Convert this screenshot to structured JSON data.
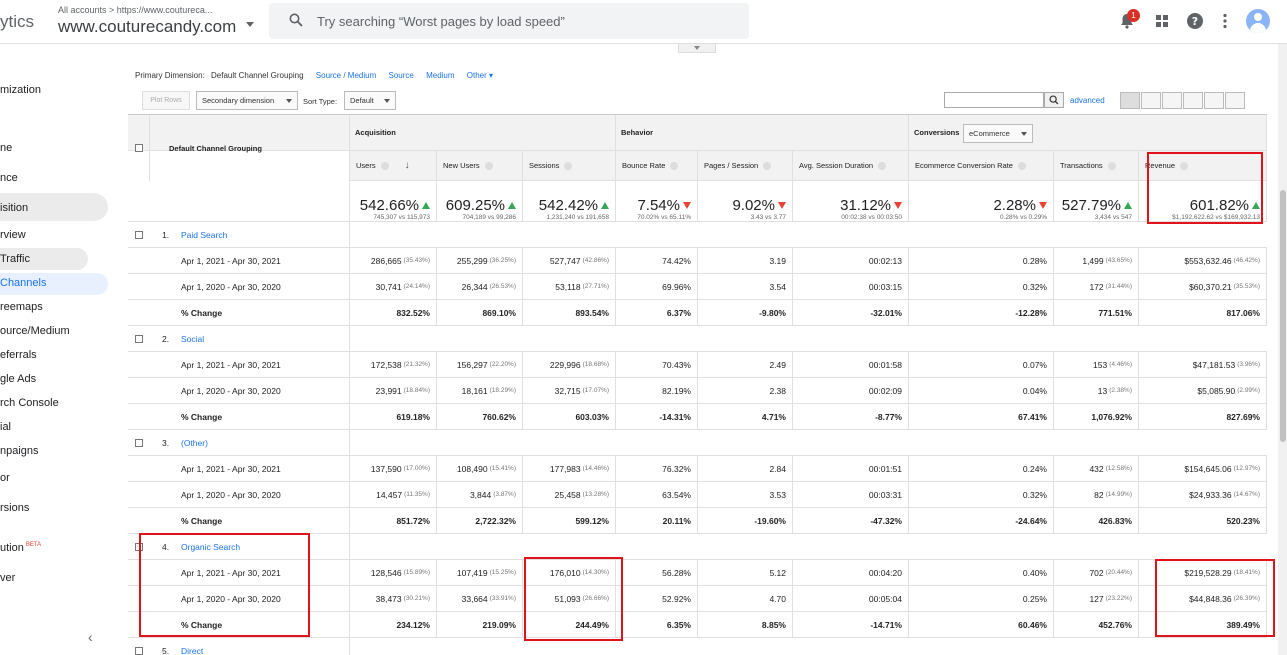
{
  "topbar": {
    "brand": "ytics",
    "account_crumb": "All accounts > https://www.couturecа...",
    "account_name": "www.couturecandy.com",
    "search_placeholder": "Try searching “Worst pages by load speed”",
    "notification_count": "1"
  },
  "sidebar": {
    "items": [
      {
        "label": "mization",
        "top": 0
      },
      {
        "label": "ne"
      },
      {
        "label": "nce"
      },
      {
        "label": "isition"
      },
      {
        "label": "rview"
      },
      {
        "label": "Traffic"
      },
      {
        "label": "Channels"
      },
      {
        "label": "reemaps"
      },
      {
        "label": "ource/Medium"
      },
      {
        "label": "eferrals"
      },
      {
        "label": "gle Ads"
      },
      {
        "label": "rch Console"
      },
      {
        "label": "ial"
      },
      {
        "label": "npaigns"
      },
      {
        "label": "or"
      },
      {
        "label": "rsions"
      },
      {
        "label": "ution"
      },
      {
        "label": "ver"
      }
    ],
    "beta": "BETA",
    "collapse": "‹"
  },
  "primary_dimension": {
    "label": "Primary Dimension:",
    "active": "Default Channel Grouping",
    "options": [
      "Source / Medium",
      "Source",
      "Medium",
      "Other ▾"
    ]
  },
  "controls": {
    "plot_rows": "Plot Rows",
    "secondary_dimension": "Secondary dimension",
    "sort_type_label": "Sort Type:",
    "sort_type_value": "Default",
    "advanced": "advanced"
  },
  "table": {
    "group_header": "Default Channel Grouping",
    "section_acquisition": "Acquisition",
    "section_behavior": "Behavior",
    "section_conversions": "Conversions",
    "conversions_select": "eCommerce",
    "columns": [
      "Users",
      "New Users",
      "Sessions",
      "Bounce Rate",
      "Pages / Session",
      "Avg. Session Duration",
      "Ecommerce Conversion Rate",
      "Transactions",
      "Revenue"
    ],
    "summary": [
      {
        "big": "542.66%",
        "sub": "745,307 vs 115,973",
        "dir": "up"
      },
      {
        "big": "609.25%",
        "sub": "704,189 vs 99,286",
        "dir": "up"
      },
      {
        "big": "542.42%",
        "sub": "1,231,240 vs 191,658",
        "dir": "up"
      },
      {
        "big": "7.54%",
        "sub": "70.02% vs 65.11%",
        "dir": "down"
      },
      {
        "big": "9.02%",
        "sub": "3.43 vs 3.77",
        "dir": "down"
      },
      {
        "big": "31.12%",
        "sub": "00:02:38 vs 00:03:50",
        "dir": "down"
      },
      {
        "big": "2.28%",
        "sub": "0.28% vs 0.29%",
        "dir": "down"
      },
      {
        "big": "527.79%",
        "sub": "3,434 vs 547",
        "dir": "up"
      },
      {
        "big": "601.82%",
        "sub": "$1,192,622.62 vs $169,932.13",
        "dir": "up"
      }
    ],
    "groups": [
      {
        "num": "1.",
        "name": "Paid Search",
        "rows": [
          {
            "label": "Apr 1, 2021 - Apr 30, 2021",
            "cells": [
              [
                "286,665",
                "(35.43%)"
              ],
              [
                "255,299",
                "(36.25%)"
              ],
              [
                "527,747",
                "(42.86%)"
              ],
              [
                "74.42%",
                ""
              ],
              [
                "3.19",
                ""
              ],
              [
                "00:02:13",
                ""
              ],
              [
                "0.28%",
                ""
              ],
              [
                "1,499",
                "(43.65%)"
              ],
              [
                "$553,632.46",
                "(46.42%)"
              ]
            ]
          },
          {
            "label": "Apr 1, 2020 - Apr 30, 2020",
            "cells": [
              [
                "30,741",
                "(24.14%)"
              ],
              [
                "26,344",
                "(26.53%)"
              ],
              [
                "53,118",
                "(27.71%)"
              ],
              [
                "69.96%",
                ""
              ],
              [
                "3.54",
                ""
              ],
              [
                "00:03:15",
                ""
              ],
              [
                "0.32%",
                ""
              ],
              [
                "172",
                "(31.44%)"
              ],
              [
                "$60,370.21",
                "(35.53%)"
              ]
            ]
          },
          {
            "label": "% Change",
            "bold": true,
            "cells": [
              [
                "832.52%",
                ""
              ],
              [
                "869.10%",
                ""
              ],
              [
                "893.54%",
                ""
              ],
              [
                "6.37%",
                ""
              ],
              [
                "-9.80%",
                ""
              ],
              [
                "-32.01%",
                ""
              ],
              [
                "-12.28%",
                ""
              ],
              [
                "771.51%",
                ""
              ],
              [
                "817.06%",
                ""
              ]
            ]
          }
        ]
      },
      {
        "num": "2.",
        "name": "Social",
        "rows": [
          {
            "label": "Apr 1, 2021 - Apr 30, 2021",
            "cells": [
              [
                "172,538",
                "(21.32%)"
              ],
              [
                "156,297",
                "(22.20%)"
              ],
              [
                "229,996",
                "(18.68%)"
              ],
              [
                "70.43%",
                ""
              ],
              [
                "2.49",
                ""
              ],
              [
                "00:01:58",
                ""
              ],
              [
                "0.07%",
                ""
              ],
              [
                "153",
                "(4.46%)"
              ],
              [
                "$47,181.53",
                "(3.96%)"
              ]
            ]
          },
          {
            "label": "Apr 1, 2020 - Apr 30, 2020",
            "cells": [
              [
                "23,991",
                "(18.84%)"
              ],
              [
                "18,161",
                "(18.29%)"
              ],
              [
                "32,715",
                "(17.07%)"
              ],
              [
                "82.19%",
                ""
              ],
              [
                "2.38",
                ""
              ],
              [
                "00:02:09",
                ""
              ],
              [
                "0.04%",
                ""
              ],
              [
                "13",
                "(2.38%)"
              ],
              [
                "$5,085.90",
                "(2.99%)"
              ]
            ]
          },
          {
            "label": "% Change",
            "bold": true,
            "cells": [
              [
                "619.18%",
                ""
              ],
              [
                "760.62%",
                ""
              ],
              [
                "603.03%",
                ""
              ],
              [
                "-14.31%",
                ""
              ],
              [
                "4.71%",
                ""
              ],
              [
                "-8.77%",
                ""
              ],
              [
                "67.41%",
                ""
              ],
              [
                "1,076.92%",
                ""
              ],
              [
                "827.69%",
                ""
              ]
            ]
          }
        ]
      },
      {
        "num": "3.",
        "name": "(Other)",
        "rows": [
          {
            "label": "Apr 1, 2021 - Apr 30, 2021",
            "cells": [
              [
                "137,590",
                "(17.00%)"
              ],
              [
                "108,490",
                "(15.41%)"
              ],
              [
                "177,983",
                "(14.46%)"
              ],
              [
                "76.32%",
                ""
              ],
              [
                "2.84",
                ""
              ],
              [
                "00:01:51",
                ""
              ],
              [
                "0.24%",
                ""
              ],
              [
                "432",
                "(12.58%)"
              ],
              [
                "$154,645.06",
                "(12.97%)"
              ]
            ]
          },
          {
            "label": "Apr 1, 2020 - Apr 30, 2020",
            "cells": [
              [
                "14,457",
                "(11.35%)"
              ],
              [
                "3,844",
                "(3.87%)"
              ],
              [
                "25,458",
                "(13.28%)"
              ],
              [
                "63.54%",
                ""
              ],
              [
                "3.53",
                ""
              ],
              [
                "00:03:31",
                ""
              ],
              [
                "0.32%",
                ""
              ],
              [
                "82",
                "(14.99%)"
              ],
              [
                "$24,933.36",
                "(14.67%)"
              ]
            ]
          },
          {
            "label": "% Change",
            "bold": true,
            "cells": [
              [
                "851.72%",
                ""
              ],
              [
                "2,722.32%",
                ""
              ],
              [
                "599.12%",
                ""
              ],
              [
                "20.11%",
                ""
              ],
              [
                "-19.60%",
                ""
              ],
              [
                "-47.32%",
                ""
              ],
              [
                "-24.64%",
                ""
              ],
              [
                "426.83%",
                ""
              ],
              [
                "520.23%",
                ""
              ]
            ]
          }
        ]
      },
      {
        "num": "4.",
        "name": "Organic Search",
        "rows": [
          {
            "label": "Apr 1, 2021 - Apr 30, 2021",
            "cells": [
              [
                "128,546",
                "(15.89%)"
              ],
              [
                "107,419",
                "(15.25%)"
              ],
              [
                "176,010",
                "(14.30%)"
              ],
              [
                "56.28%",
                ""
              ],
              [
                "5.12",
                ""
              ],
              [
                "00:04:20",
                ""
              ],
              [
                "0.40%",
                ""
              ],
              [
                "702",
                "(20.44%)"
              ],
              [
                "$219,528.29",
                "(18.41%)"
              ]
            ]
          },
          {
            "label": "Apr 1, 2020 - Apr 30, 2020",
            "cells": [
              [
                "38,473",
                "(30.21%)"
              ],
              [
                "33,664",
                "(33.91%)"
              ],
              [
                "51,093",
                "(26.66%)"
              ],
              [
                "52.92%",
                ""
              ],
              [
                "4.70",
                ""
              ],
              [
                "00:05:04",
                ""
              ],
              [
                "0.25%",
                ""
              ],
              [
                "127",
                "(23.22%)"
              ],
              [
                "$44,848.36",
                "(26.39%)"
              ]
            ]
          },
          {
            "label": "% Change",
            "bold": true,
            "cells": [
              [
                "234.12%",
                ""
              ],
              [
                "219.09%",
                ""
              ],
              [
                "244.49%",
                ""
              ],
              [
                "6.35%",
                ""
              ],
              [
                "8.85%",
                ""
              ],
              [
                "-14.71%",
                ""
              ],
              [
                "60.46%",
                ""
              ],
              [
                "452.76%",
                ""
              ],
              [
                "389.49%",
                ""
              ]
            ]
          }
        ]
      },
      {
        "num": "5.",
        "name": "Direct",
        "rows": []
      }
    ]
  },
  "colors": {
    "accent": "#1a73e8",
    "highlight": "#e0131b",
    "positive": "#34a853",
    "negative": "#ea4335"
  }
}
